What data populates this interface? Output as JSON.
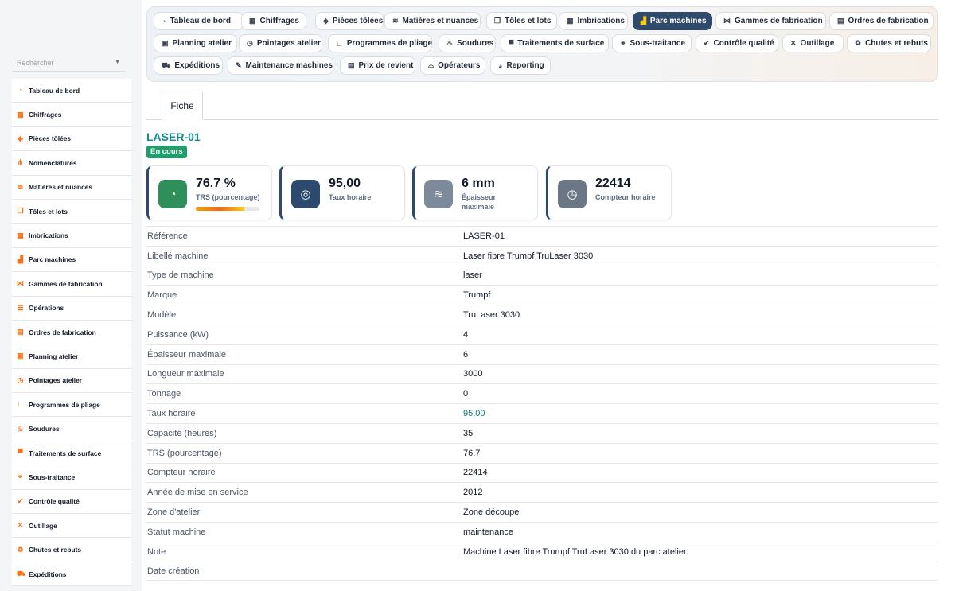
{
  "sidebar": {
    "search_placeholder": "Rechercher",
    "items": [
      {
        "label": "Tableau de bord",
        "icon": "gauge-icon"
      },
      {
        "label": "Chiffrages",
        "icon": "calculator-icon"
      },
      {
        "label": "Pièces tôlées",
        "icon": "cube-icon"
      },
      {
        "label": "Nomenclatures",
        "icon": "sitemap-icon"
      },
      {
        "label": "Matières et nuances",
        "icon": "layers-icon"
      },
      {
        "label": "Tôles et lots",
        "icon": "copy-icon"
      },
      {
        "label": "Imbrications",
        "icon": "grid-icon"
      },
      {
        "label": "Parc machines",
        "icon": "industry-icon"
      },
      {
        "label": "Gammes de fabrication",
        "icon": "diagram-icon"
      },
      {
        "label": "Opérations",
        "icon": "list-icon"
      },
      {
        "label": "Ordres de fabrication",
        "icon": "clipboard-icon"
      },
      {
        "label": "Planning atelier",
        "icon": "calendar-icon"
      },
      {
        "label": "Pointages atelier",
        "icon": "clock-icon"
      },
      {
        "label": "Programmes de pliage",
        "icon": "angle-icon"
      },
      {
        "label": "Soudures",
        "icon": "flame-icon"
      },
      {
        "label": "Traitements de surface",
        "icon": "paint-roller-icon"
      },
      {
        "label": "Sous-traitance",
        "icon": "handshake-icon"
      },
      {
        "label": "Contrôle qualité",
        "icon": "check-double-icon"
      },
      {
        "label": "Outillage",
        "icon": "tools-icon"
      },
      {
        "label": "Chutes et rebuts",
        "icon": "recycle-icon"
      },
      {
        "label": "Expéditions",
        "icon": "truck-icon"
      }
    ]
  },
  "topnav": {
    "tabs": [
      {
        "label": "Tableau de bord",
        "icon": "gauge-icon"
      },
      {
        "label": "Chiffrages",
        "icon": "calculator-icon"
      },
      {
        "label": "Pièces tôlées",
        "icon": "cube-icon"
      },
      {
        "label": "Matières et nuances",
        "icon": "layers-icon"
      },
      {
        "label": "Tôles et lots",
        "icon": "copy-icon"
      },
      {
        "label": "Imbrications",
        "icon": "grid-icon"
      },
      {
        "label": "Parc machines",
        "icon": "industry-icon",
        "active": true
      },
      {
        "label": "Gammes de fabrication",
        "icon": "diagram-icon"
      },
      {
        "label": "Ordres de fabrication",
        "icon": "clipboard-icon"
      },
      {
        "label": "Planning atelier",
        "icon": "calendar-icon"
      },
      {
        "label": "Pointages atelier",
        "icon": "clock-icon"
      },
      {
        "label": "Programmes de pliage",
        "icon": "angle-icon"
      },
      {
        "label": "Soudures",
        "icon": "flame-icon"
      },
      {
        "label": "Traitements de surface",
        "icon": "paint-roller-icon"
      },
      {
        "label": "Sous-traitance",
        "icon": "handshake-icon"
      },
      {
        "label": "Contrôle qualité",
        "icon": "check-double-icon"
      },
      {
        "label": "Outillage",
        "icon": "tools-icon"
      },
      {
        "label": "Chutes et rebuts",
        "icon": "recycle-icon"
      },
      {
        "label": "Expéditions",
        "icon": "truck-icon"
      },
      {
        "label": "Maintenance machines",
        "icon": "wrench-icon"
      },
      {
        "label": "Prix de revient",
        "icon": "receipt-icon"
      },
      {
        "label": "Opérateurs",
        "icon": "hard-hat-icon"
      },
      {
        "label": "Reporting",
        "icon": "pie-chart-icon"
      }
    ]
  },
  "subtab": {
    "label": "Fiche"
  },
  "record": {
    "title": "LASER-01",
    "status": "En cours"
  },
  "kpis": [
    {
      "value": "76.7 %",
      "label": "TRS (pourcentage)",
      "icon": "gauge-icon",
      "color": "#2f8f5b",
      "progress": 0.767
    },
    {
      "value": "95,00",
      "label": "Taux horaire",
      "icon": "coins-icon",
      "color": "#2b4a6e"
    },
    {
      "value": "6 mm",
      "label": "Épaisseur maximale",
      "icon": "layers-icon",
      "color": "#7d8a99"
    },
    {
      "value": "22414",
      "label": "Compteur horaire",
      "icon": "clock-icon",
      "color": "#6b7785"
    }
  ],
  "fields": [
    {
      "key": "Référence",
      "value": "LASER-01"
    },
    {
      "key": "Libellé machine",
      "value": "Laser fibre Trumpf TruLaser 3030"
    },
    {
      "key": "Type de machine",
      "value": "laser"
    },
    {
      "key": "Marque",
      "value": "Trumpf"
    },
    {
      "key": "Modèle",
      "value": "TruLaser 3030"
    },
    {
      "key": "Puissance (kW)",
      "value": "4"
    },
    {
      "key": "Épaisseur maximale",
      "value": "6"
    },
    {
      "key": "Longueur maximale",
      "value": "3000"
    },
    {
      "key": "Tonnage",
      "value": "0"
    },
    {
      "key": "Taux horaire",
      "value": "95,00",
      "link": true
    },
    {
      "key": "Capacité (heures)",
      "value": "35"
    },
    {
      "key": "TRS (pourcentage)",
      "value": "76.7"
    },
    {
      "key": "Compteur horaire",
      "value": "22414"
    },
    {
      "key": "Année de mise en service",
      "value": "2012"
    },
    {
      "key": "Zone d'atelier",
      "value": "Zone découpe"
    },
    {
      "key": "Statut machine",
      "value": "maintenance"
    },
    {
      "key": "Note",
      "value": "Machine Laser fibre Trumpf TruLaser 3030 du parc atelier."
    },
    {
      "key": "Date création",
      "value": ""
    }
  ],
  "colors": {
    "accent": "#0f8c8c",
    "active_tab": "#2f4a6a",
    "status_badge": "#1f9d6b",
    "icon_orange": "#f97316"
  }
}
